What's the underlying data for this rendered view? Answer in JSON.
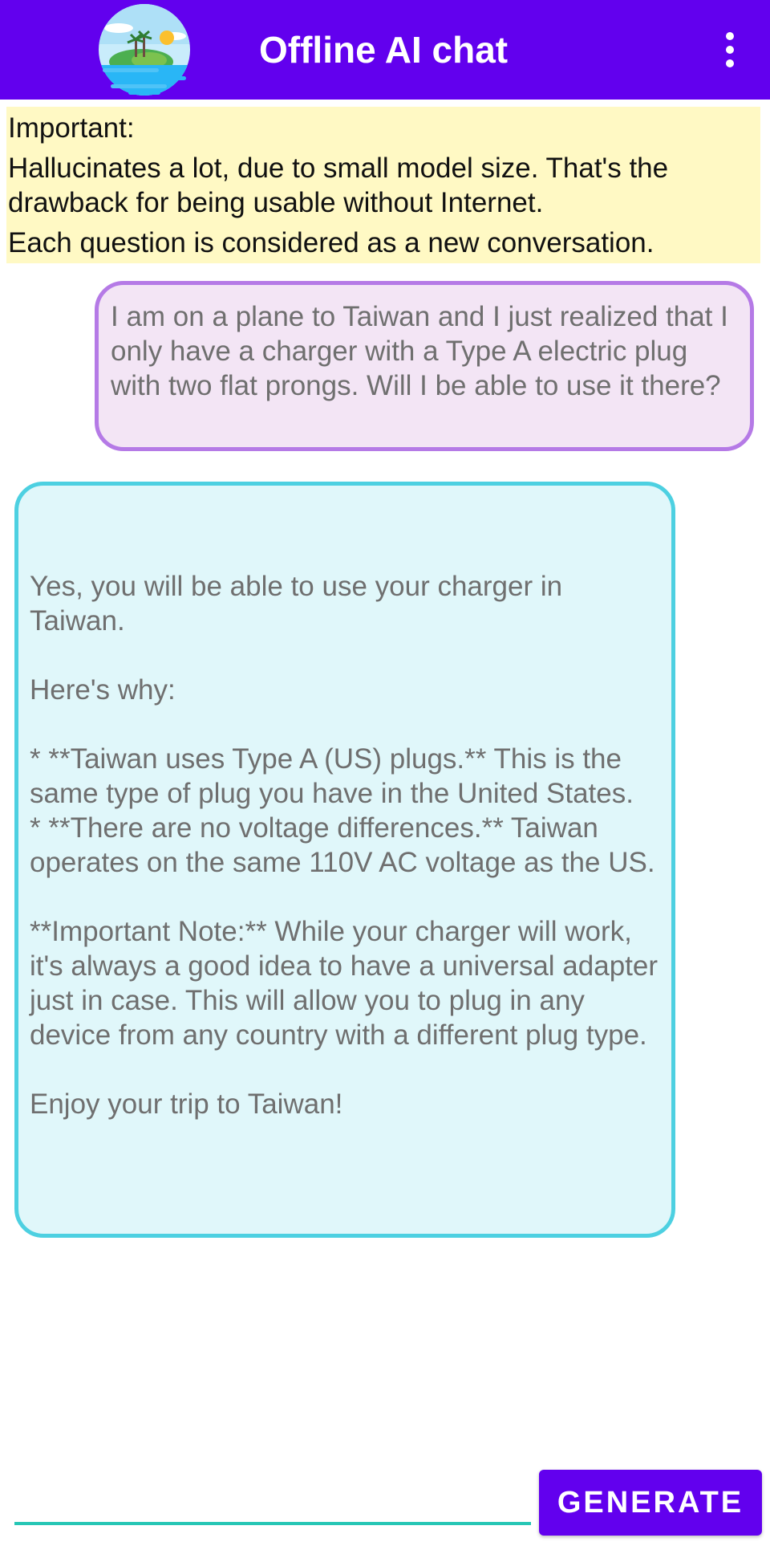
{
  "app_bar": {
    "title": "Offline AI chat",
    "logo_icon": "island-sunset-logo",
    "menu_icon": "more-vert-icon",
    "background_color": "#6200ee"
  },
  "notice": {
    "heading": "Important:",
    "line1": "Hallucinates a lot, due to small model size. That's the drawback for being usable without Internet.",
    "line2": "Each question is considered as a new conversation.",
    "background_color": "#fff9c4"
  },
  "chat": {
    "user_message": "I am on a plane to Taiwan and I just realized that I only have a charger with a Type A electric plug with two flat prongs. Will I be able to use it there?",
    "ai_response": "Yes, you will be able to use your charger in Taiwan.\n\nHere's why:\n\n* **Taiwan uses Type A (US) plugs.** This is the same type of plug you have in the United States.\n* **There are no voltage differences.** Taiwan operates on the same 110V AC voltage as the US.\n\n**Important Note:** While your charger will work, it's always a good idea to have a universal adapter just in case. This will allow you to plug in any device from any country with a different plug type.\n\nEnjoy your trip to Taiwan!",
    "user_bubble_color": "#f3e5f5",
    "user_border_color": "#b57ae6",
    "ai_bubble_color": "#e0f7fa",
    "ai_border_color": "#4dd0e1"
  },
  "composer": {
    "input_value": "",
    "input_placeholder": "",
    "generate_label": "GENERATE",
    "accent_color": "#26c6b5"
  }
}
